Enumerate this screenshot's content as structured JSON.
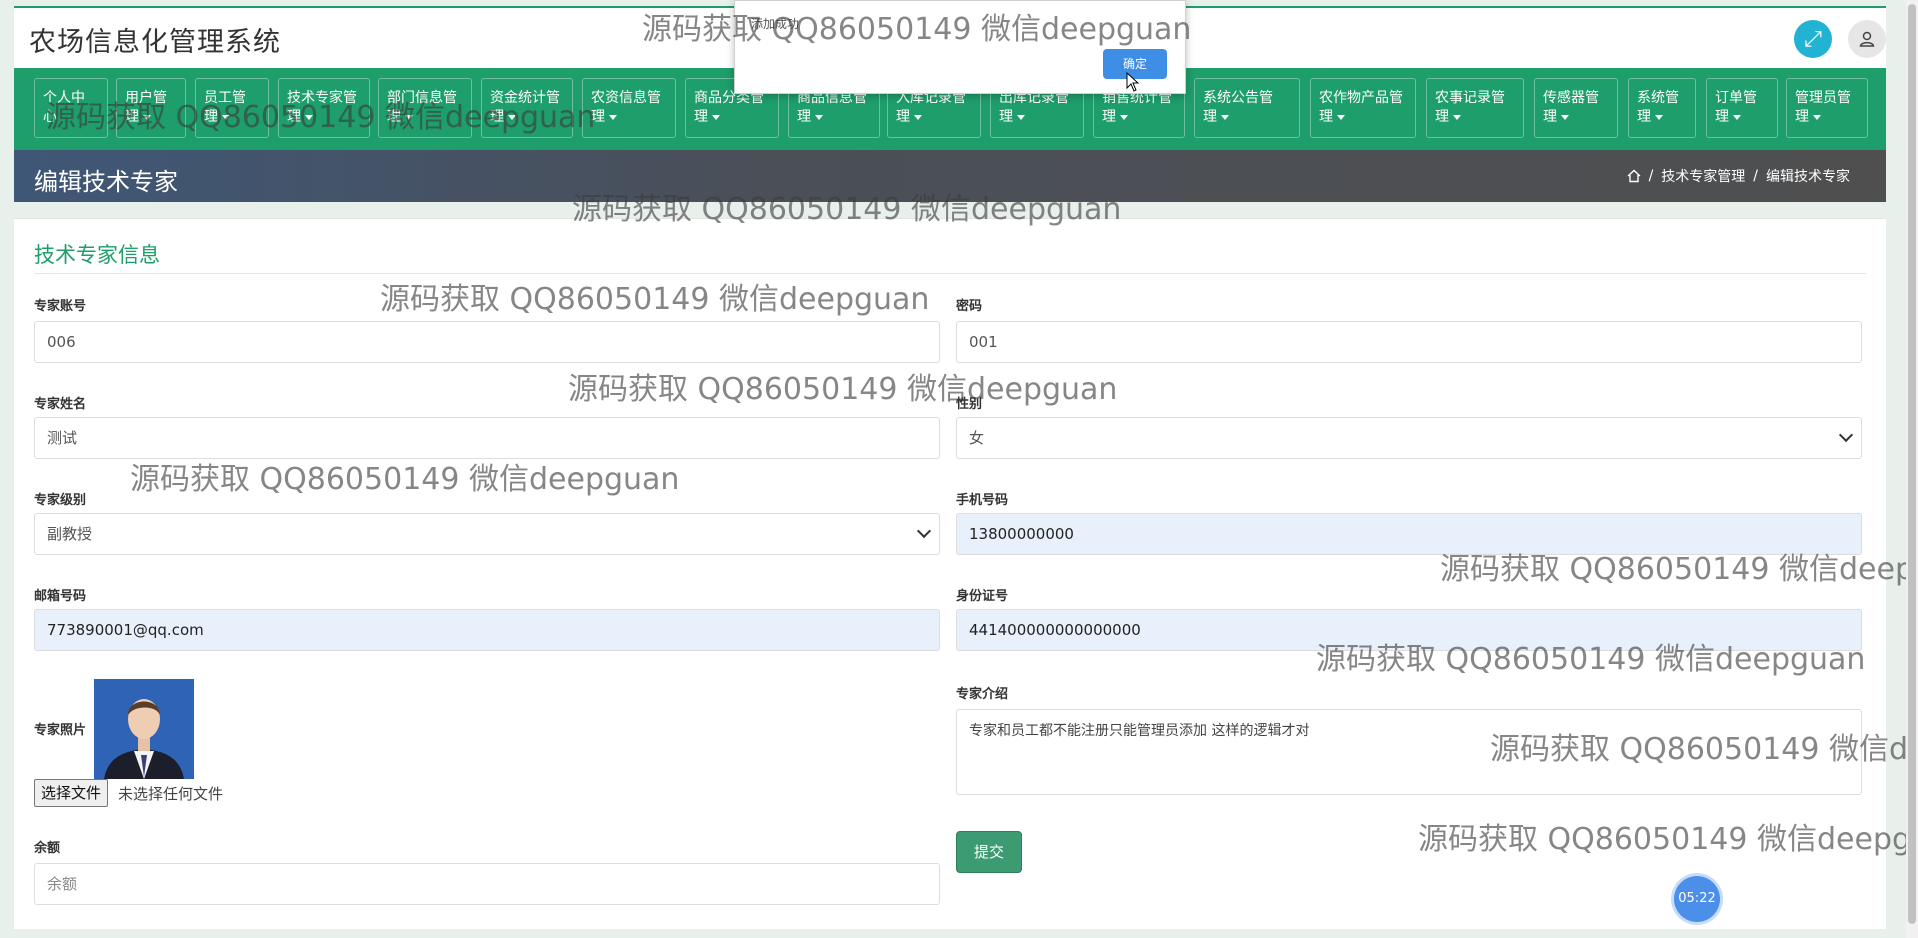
{
  "app": {
    "title": "农场信息化管理系统"
  },
  "topbar": {
    "expand_icon": "⤢",
    "user_icon": "👤"
  },
  "nav": [
    {
      "l1": "个人中",
      "l2": "心"
    },
    {
      "l1": "用户管",
      "l2": "理"
    },
    {
      "l1": "员工管",
      "l2": "理"
    },
    {
      "l1": "技术专家管",
      "l2": "理"
    },
    {
      "l1": "部门信息管",
      "l2": "理"
    },
    {
      "l1": "资金统计管",
      "l2": "理"
    },
    {
      "l1": "农资信息管",
      "l2": "理"
    },
    {
      "l1": "商品分类管",
      "l2": "理"
    },
    {
      "l1": "商品信息管",
      "l2": "理"
    },
    {
      "l1": "入库记录管",
      "l2": "理"
    },
    {
      "l1": "出库记录管",
      "l2": "理"
    },
    {
      "l1": "销售统计管",
      "l2": "理"
    },
    {
      "l1": "系统公告管",
      "l2": "理"
    },
    {
      "l1": "农作物产品管",
      "l2": "理"
    },
    {
      "l1": "农事记录管",
      "l2": "理"
    },
    {
      "l1": "传感器管",
      "l2": "理"
    },
    {
      "l1": "系统管",
      "l2": "理"
    },
    {
      "l1": "订单管",
      "l2": "理"
    },
    {
      "l1": "管理员管",
      "l2": "理"
    }
  ],
  "page_header": {
    "title": "编辑技术专家",
    "breadcrumb_1": "技术专家管理",
    "sep": "/",
    "breadcrumb_2": "编辑技术专家"
  },
  "form": {
    "section_title": "技术专家信息",
    "account_label": "专家账号",
    "account_value": "006",
    "password_label": "密码",
    "password_value": "001",
    "name_label": "专家姓名",
    "name_value": "测试",
    "gender_label": "性别",
    "gender_value": "女",
    "level_label": "专家级别",
    "level_value": "副教授",
    "phone_label": "手机号码",
    "phone_value": "13800000000",
    "email_label": "邮箱号码",
    "email_value": "773890001@qq.com",
    "idcard_label": "身份证号",
    "idcard_value": "441400000000000000",
    "photo_label": "专家照片",
    "file_button": "选择文件",
    "file_none": "未选择任何文件",
    "intro_label": "专家介绍",
    "intro_value": "专家和员工都不能注册只能管理员添加 这样的逻辑才对",
    "balance_label": "余额",
    "balance_placeholder": "余额",
    "submit": "提交"
  },
  "dialog": {
    "message": "添加成功",
    "ok": "确定"
  },
  "timer": "05:22",
  "watermark": "源码获取 QQ86050149 微信deepguan"
}
